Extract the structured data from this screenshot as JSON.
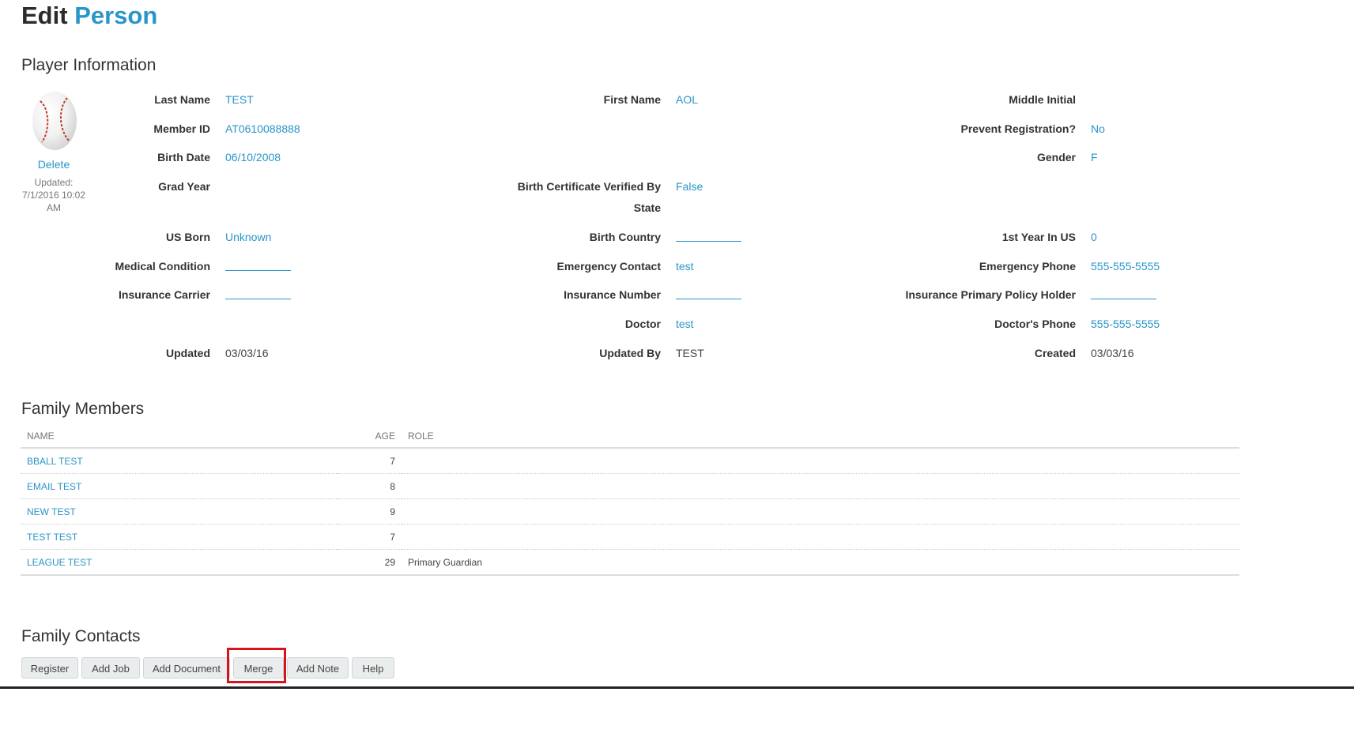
{
  "page_title": {
    "prefix": "Edit",
    "accent": "Person"
  },
  "player_info": {
    "heading": "Player Information",
    "avatar_icon": "baseball-icon",
    "delete_label": "Delete",
    "updated_note": "Updated: 7/1/2016 10:02 AM",
    "fields": {
      "last_name": {
        "label": "Last Name",
        "value": "TEST"
      },
      "first_name": {
        "label": "First Name",
        "value": "AOL"
      },
      "middle_initial": {
        "label": "Middle Initial",
        "value": ""
      },
      "member_id": {
        "label": "Member ID",
        "value": "AT0610088888"
      },
      "prevent_registration": {
        "label": "Prevent Registration?",
        "value": "No"
      },
      "birth_date": {
        "label": "Birth Date",
        "value": "06/10/2008"
      },
      "gender": {
        "label": "Gender",
        "value": "F"
      },
      "grad_year": {
        "label": "Grad Year",
        "value": ""
      },
      "birth_cert_verified": {
        "label": "Birth Certificate Verified By",
        "value": "False"
      },
      "state": {
        "label": "State",
        "value": ""
      },
      "us_born": {
        "label": "US Born",
        "value": "Unknown"
      },
      "birth_country": {
        "label": "Birth Country",
        "value": ""
      },
      "first_year_in_us": {
        "label": "1st Year In US",
        "value": "0"
      },
      "medical_condition": {
        "label": "Medical Condition",
        "value": ""
      },
      "emergency_contact": {
        "label": "Emergency Contact",
        "value": "test"
      },
      "emergency_phone": {
        "label": "Emergency Phone",
        "value": "555-555-5555"
      },
      "insurance_carrier": {
        "label": "Insurance Carrier",
        "value": ""
      },
      "insurance_number": {
        "label": "Insurance Number",
        "value": ""
      },
      "insurance_holder": {
        "label": "Insurance Primary Policy Holder",
        "value": ""
      },
      "doctor": {
        "label": "Doctor",
        "value": "test"
      },
      "doctor_phone": {
        "label": "Doctor's Phone",
        "value": "555-555-5555"
      },
      "updated": {
        "label": "Updated",
        "value": "03/03/16"
      },
      "updated_by": {
        "label": "Updated By",
        "value": "TEST"
      },
      "created": {
        "label": "Created",
        "value": "03/03/16"
      }
    }
  },
  "family_members": {
    "heading": "Family Members",
    "columns": {
      "name": "NAME",
      "age": "AGE",
      "role": "ROLE"
    },
    "rows": [
      {
        "name": "BBALL TEST",
        "age": "7",
        "role": ""
      },
      {
        "name": "EMAIL TEST",
        "age": "8",
        "role": ""
      },
      {
        "name": "NEW TEST",
        "age": "9",
        "role": ""
      },
      {
        "name": "TEST TEST",
        "age": "7",
        "role": ""
      },
      {
        "name": "LEAGUE TEST",
        "age": "29",
        "role": "Primary Guardian"
      }
    ]
  },
  "family_contacts": {
    "heading": "Family Contacts"
  },
  "actions": {
    "register": "Register",
    "add_job": "Add Job",
    "add_document": "Add Document",
    "merge": "Merge",
    "add_note": "Add Note",
    "help": "Help"
  },
  "colors": {
    "accent": "#2a95c8",
    "highlight": "#d7131e"
  }
}
